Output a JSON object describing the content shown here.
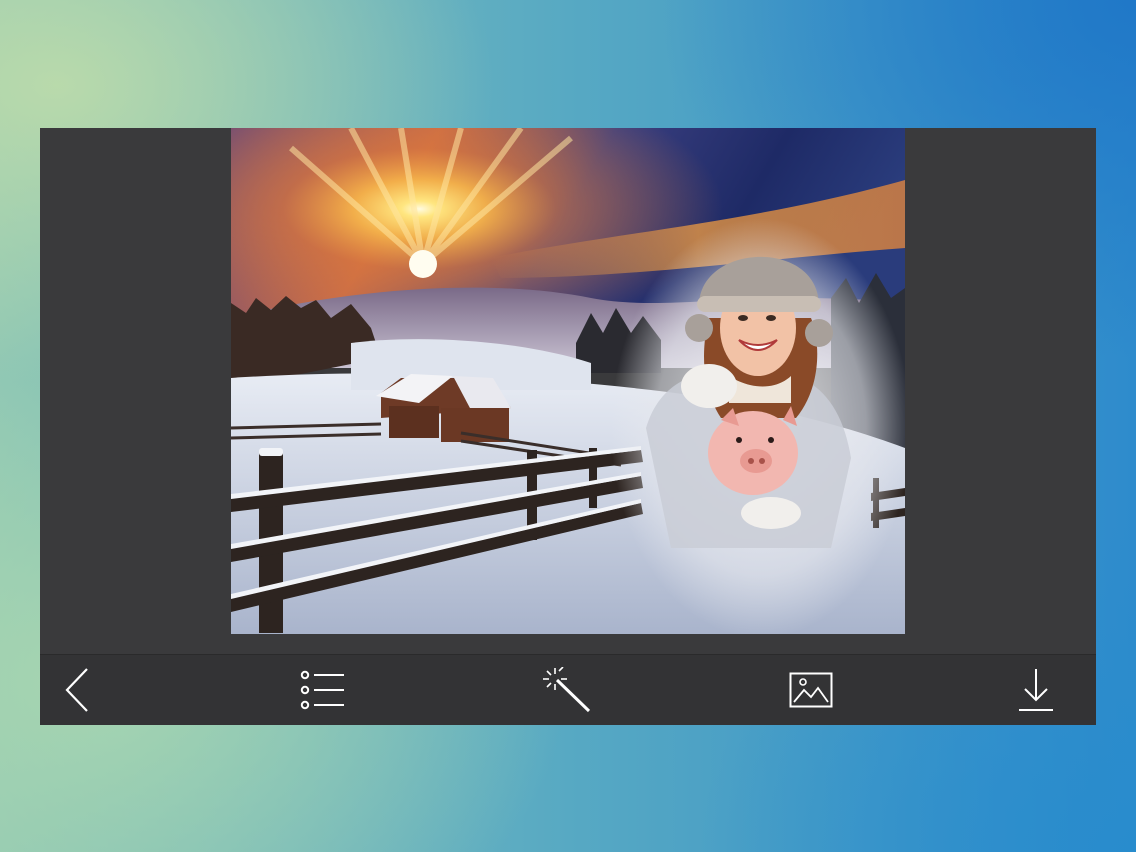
{
  "app": {
    "canvas": {
      "scene": "winter-sunset-snow-fence-cabin",
      "subject": "woman-with-piggy-bank"
    }
  },
  "toolbar": {
    "items": [
      {
        "id": "back",
        "icon": "chevron-left-icon"
      },
      {
        "id": "frames",
        "icon": "list-icon"
      },
      {
        "id": "effects",
        "icon": "magic-wand-icon"
      },
      {
        "id": "gallery",
        "icon": "image-icon"
      },
      {
        "id": "download",
        "icon": "download-icon"
      }
    ]
  },
  "colors": {
    "panel": "#3a3a3c",
    "toolbar": "#333335",
    "icon": "#ffffff"
  }
}
